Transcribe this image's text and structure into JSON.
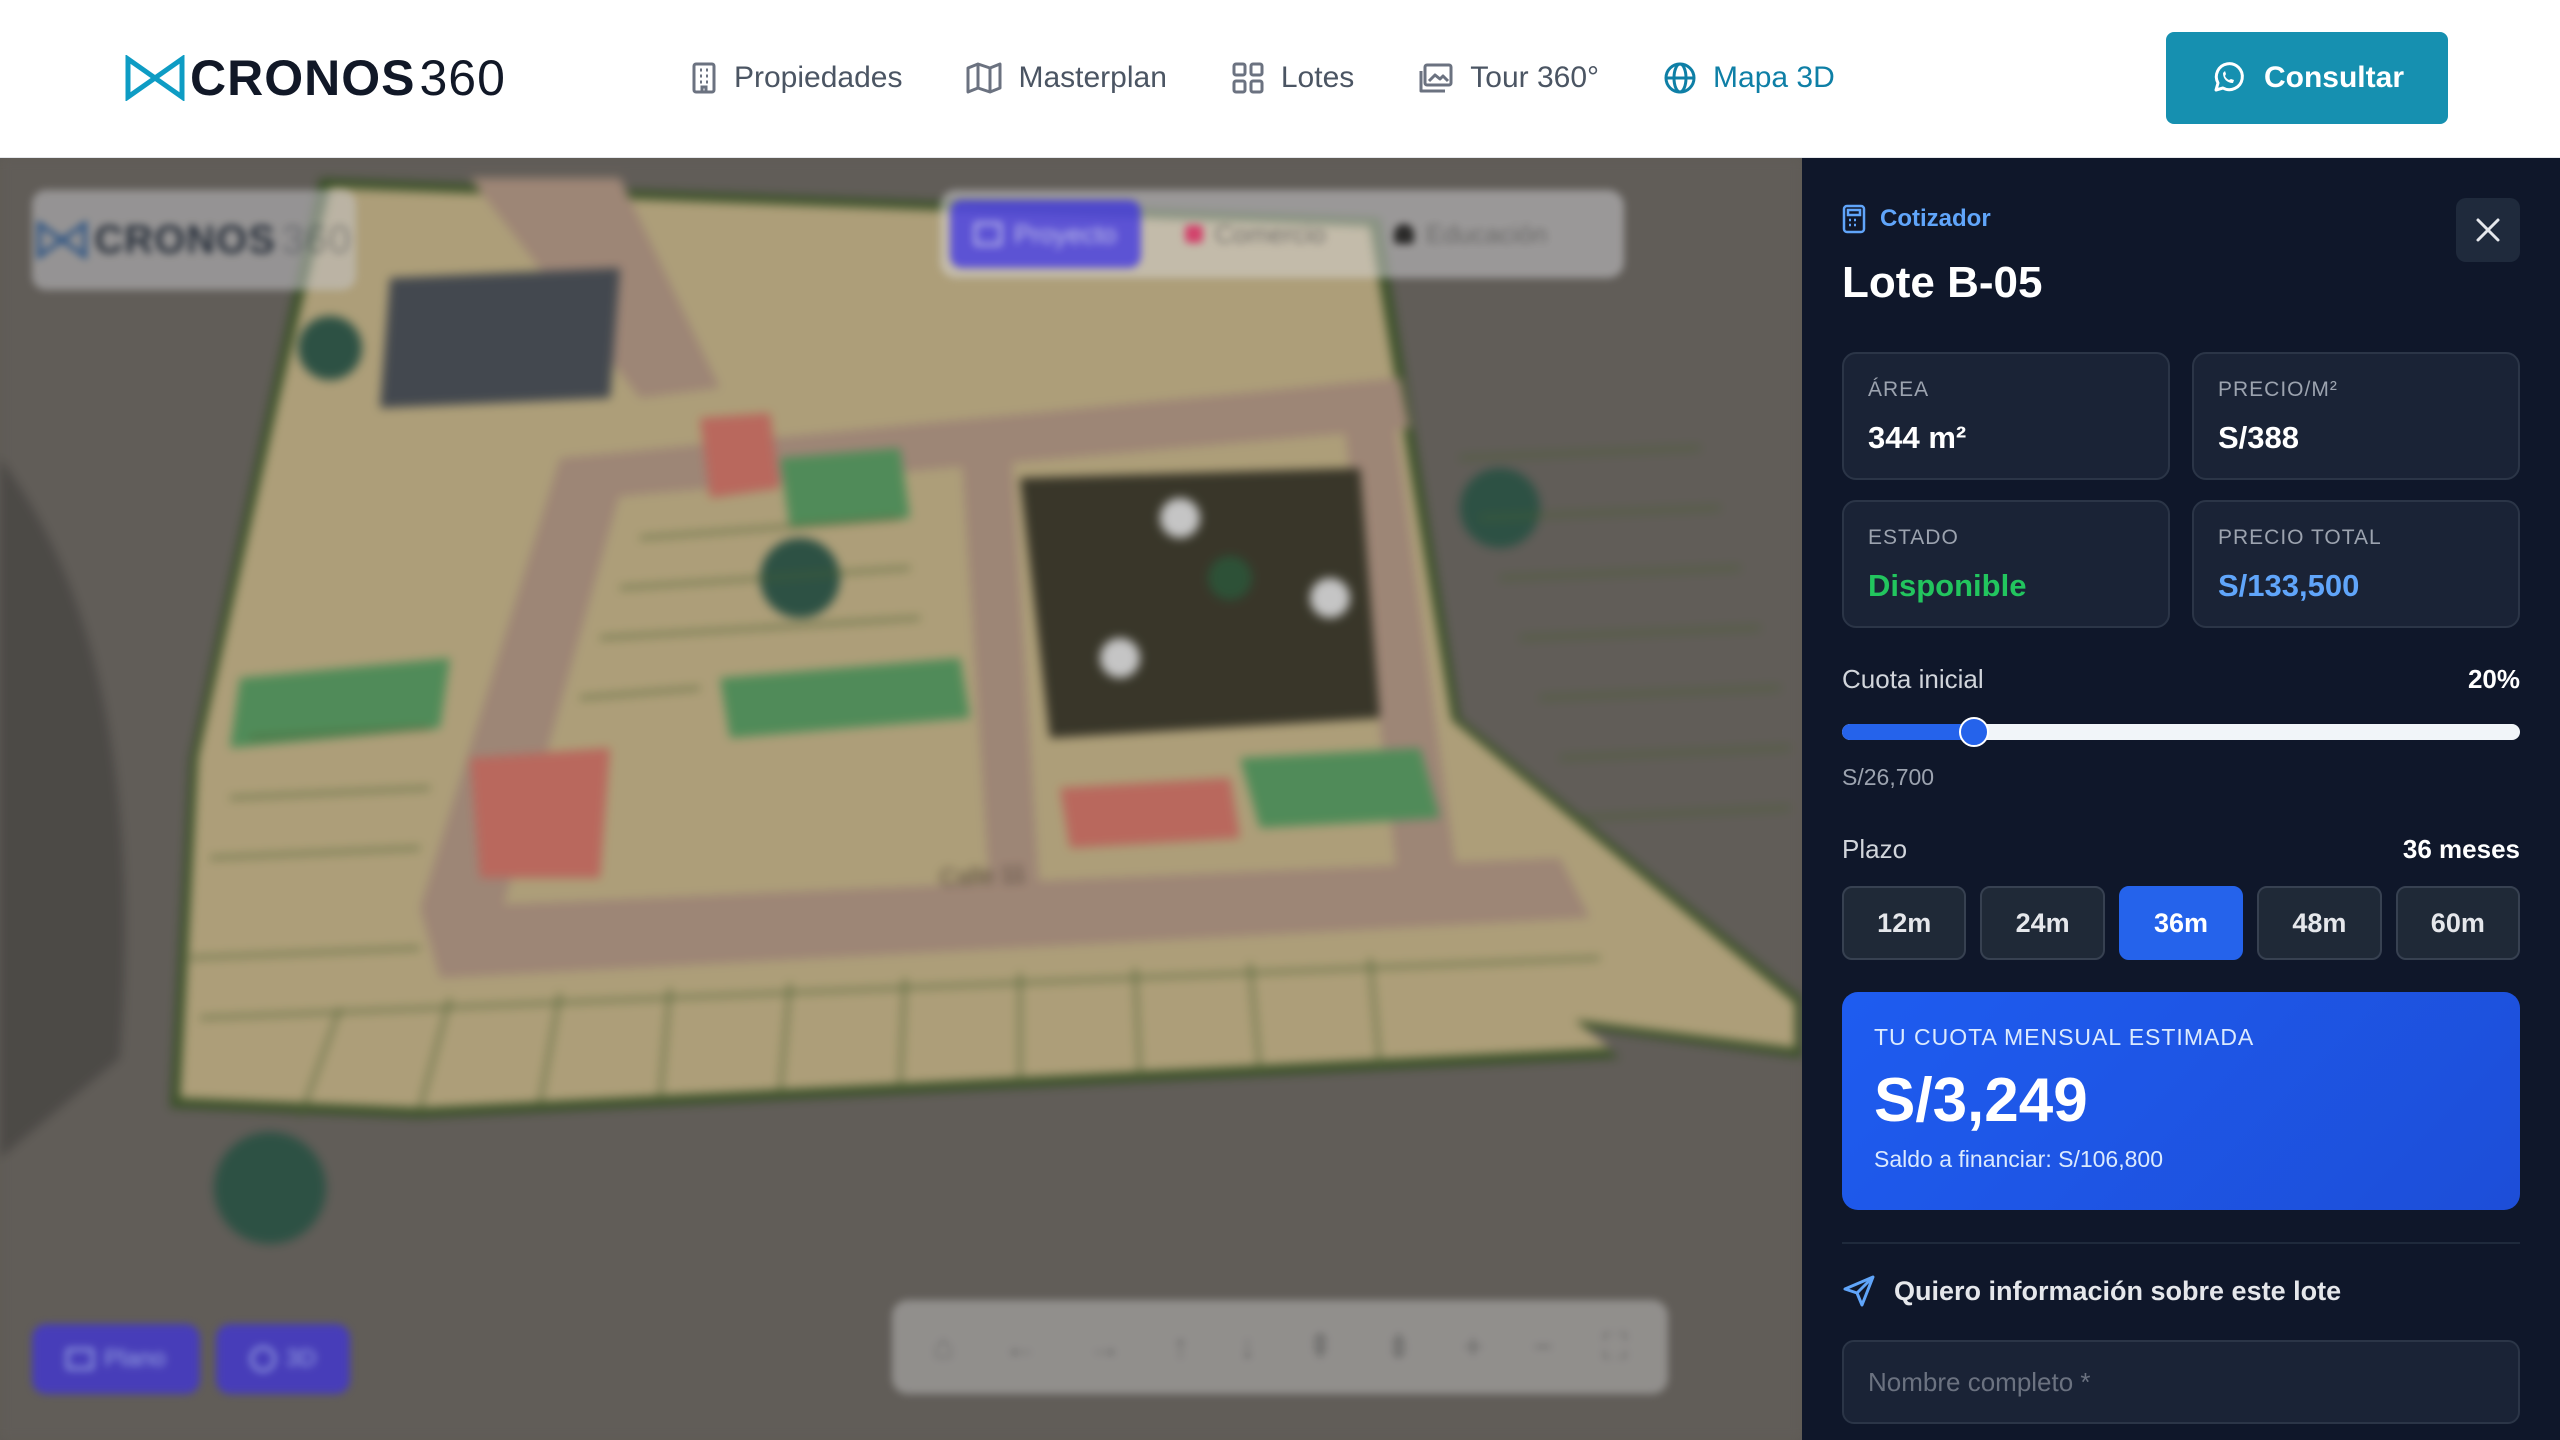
{
  "header": {
    "brand_main": "CRONOS",
    "brand_num": "360",
    "nav": [
      {
        "label": "Propiedades",
        "icon": "building-icon"
      },
      {
        "label": "Masterplan",
        "icon": "map-icon"
      },
      {
        "label": "Lotes",
        "icon": "grid-icon"
      },
      {
        "label": "Tour 360°",
        "icon": "image-icon"
      },
      {
        "label": "Mapa 3D",
        "icon": "globe-icon",
        "active": true
      }
    ],
    "consult_label": "Consultar"
  },
  "map": {
    "logo_main": "CRONOS",
    "logo_num": "360",
    "tabs": [
      {
        "label": "Proyecto",
        "active": true
      },
      {
        "label": "Comercio"
      },
      {
        "label": "Educación"
      }
    ],
    "street_label": "Calle 11",
    "view_buttons": [
      "Plano",
      "3D"
    ],
    "controls": [
      "home-icon",
      "arrow-left-icon",
      "arrow-right-icon",
      "arrow-up-icon",
      "arrow-down-icon",
      "tilt-up-icon",
      "tilt-down-icon",
      "zoom-in-icon",
      "zoom-out-icon",
      "fullscreen-icon"
    ]
  },
  "panel": {
    "kicker": "Cotizador",
    "title": "Lote B-05",
    "stats": {
      "area_label": "ÁREA",
      "area_value": "344 m²",
      "price_m2_label": "PRECIO/M²",
      "price_m2_value": "S/388",
      "status_label": "ESTADO",
      "status_value": "Disponible",
      "total_label": "PRECIO TOTAL",
      "total_value": "S/133,500"
    },
    "initial_fee_label": "Cuota inicial",
    "initial_fee_percent": "20%",
    "initial_fee_fraction": 0.2,
    "initial_fee_amount": "S/26,700",
    "term_label": "Plazo",
    "term_value": "36 meses",
    "terms": [
      {
        "label": "12m"
      },
      {
        "label": "24m"
      },
      {
        "label": "36m",
        "active": true
      },
      {
        "label": "48m"
      },
      {
        "label": "60m"
      }
    ],
    "quota_kicker": "TU CUOTA MENSUAL ESTIMADA",
    "quota_amount": "S/3,249",
    "quota_sub": "Saldo a financiar: S/106,800",
    "info_label": "Quiero información sobre este lote",
    "name_placeholder": "Nombre completo *"
  },
  "colors": {
    "accent": "#1690b0",
    "panel_bg": "#0f172a",
    "primary_blue": "#2563eb",
    "available_green": "#22c55e"
  }
}
